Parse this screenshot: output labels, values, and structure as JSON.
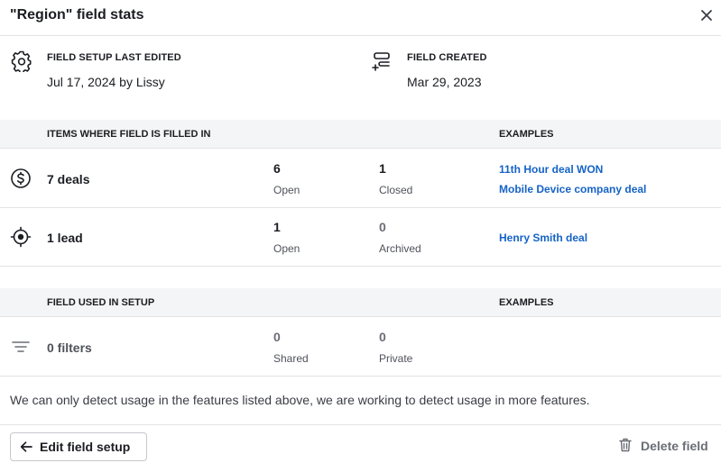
{
  "dialog": {
    "title": "\"Region\" field stats",
    "close_icon": "close-icon"
  },
  "meta": {
    "setup_edited": {
      "label": "FIELD SETUP LAST EDITED",
      "value": "Jul 17, 2024 by Lissy",
      "icon": "gear-icon"
    },
    "created": {
      "label": "FIELD CREATED",
      "value": "Mar 29, 2023",
      "icon": "field-add-icon"
    }
  },
  "filled_section": {
    "col_a": "ITEMS WHERE FIELD IS FILLED IN",
    "col_b": "EXAMPLES",
    "rows": [
      {
        "icon": "dollar-circle-icon",
        "label": "7 deals",
        "stats": [
          {
            "num": "6",
            "label": "Open"
          },
          {
            "num": "1",
            "label": "Closed"
          }
        ],
        "examples": [
          "11th Hour deal WON",
          "Mobile Device company deal"
        ]
      },
      {
        "icon": "target-icon",
        "label": "1 lead",
        "stats": [
          {
            "num": "1",
            "label": "Open"
          },
          {
            "num": "0",
            "label": "Archived"
          }
        ],
        "examples": [
          "Henry Smith deal"
        ]
      }
    ]
  },
  "setup_section": {
    "col_a": "FIELD USED IN SETUP",
    "col_b": "EXAMPLES",
    "rows": [
      {
        "icon": "filter-icon",
        "label": "0 filters",
        "stats": [
          {
            "num": "0",
            "label": "Shared"
          },
          {
            "num": "0",
            "label": "Private"
          }
        ],
        "examples": []
      }
    ]
  },
  "note": "We can only detect usage in the features listed above, we are working to detect usage in more features.",
  "footer": {
    "edit_label": "Edit field setup",
    "edit_icon": "arrow-left-icon",
    "delete_label": "Delete field",
    "delete_icon": "trash-icon"
  },
  "colors": {
    "link": "#1563c6",
    "section_bg": "#f4f5f6",
    "border": "#e2e3e6"
  }
}
